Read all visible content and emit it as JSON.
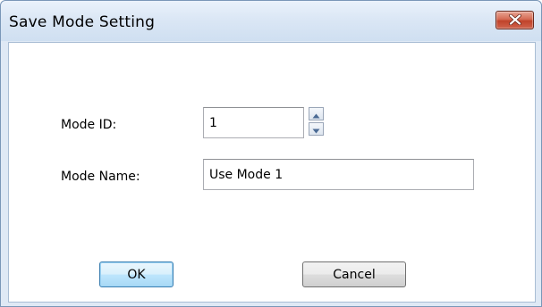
{
  "window": {
    "title": "Save Mode Setting",
    "close_icon": "close-icon"
  },
  "form": {
    "mode_id_label": "Mode ID:",
    "mode_id_value": "1",
    "spin_up_icon": "triangle-up-icon",
    "spin_down_icon": "triangle-down-icon",
    "mode_name_label": "Mode Name:",
    "mode_name_value": "Use Mode 1"
  },
  "buttons": {
    "ok_label": "OK",
    "cancel_label": "Cancel"
  },
  "colors": {
    "close_button": "#c7452d",
    "default_button_border": "#3c7fb1",
    "titlebar": "#dbe7f5"
  }
}
